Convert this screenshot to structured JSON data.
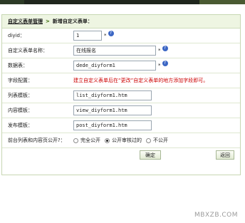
{
  "breadcrumb": {
    "parent": "自定义表单管理",
    "separator": ">",
    "current": "新增自定义表单："
  },
  "form": {
    "diyid": {
      "label": "diyid：",
      "value": "1",
      "required": "*"
    },
    "name": {
      "label": "自定义表单名称：",
      "value": "在线报名",
      "required": "*"
    },
    "table": {
      "label": "数据表：",
      "value": "dede_diyform1",
      "required": "*"
    },
    "fields": {
      "label": "字段配置：",
      "tip": "建立自定义表单后在“更改”自定义表单的地方添加字段即可。"
    },
    "list_template": {
      "label": "列表模板：",
      "value": "list_diyform1.htm"
    },
    "view_template": {
      "label": "内容模板：",
      "value": "view_diyform1.htm"
    },
    "post_template": {
      "label": "发布模板：",
      "value": "post_diyform1.htm"
    },
    "public": {
      "label": "前台列表和内容页公开?：",
      "options": [
        "完全公开",
        "公开审核过的",
        "不公开"
      ],
      "selected": "公开审核过的"
    }
  },
  "buttons": {
    "confirm": "确定",
    "back": "返回"
  },
  "watermark": "MBXZB.COM",
  "colors": {
    "topbar": "#1f261d",
    "header_bg": "#eef5e2",
    "border": "#c7d7b3",
    "tip_red": "#cc0000",
    "help_blue": "#3b66c4"
  }
}
